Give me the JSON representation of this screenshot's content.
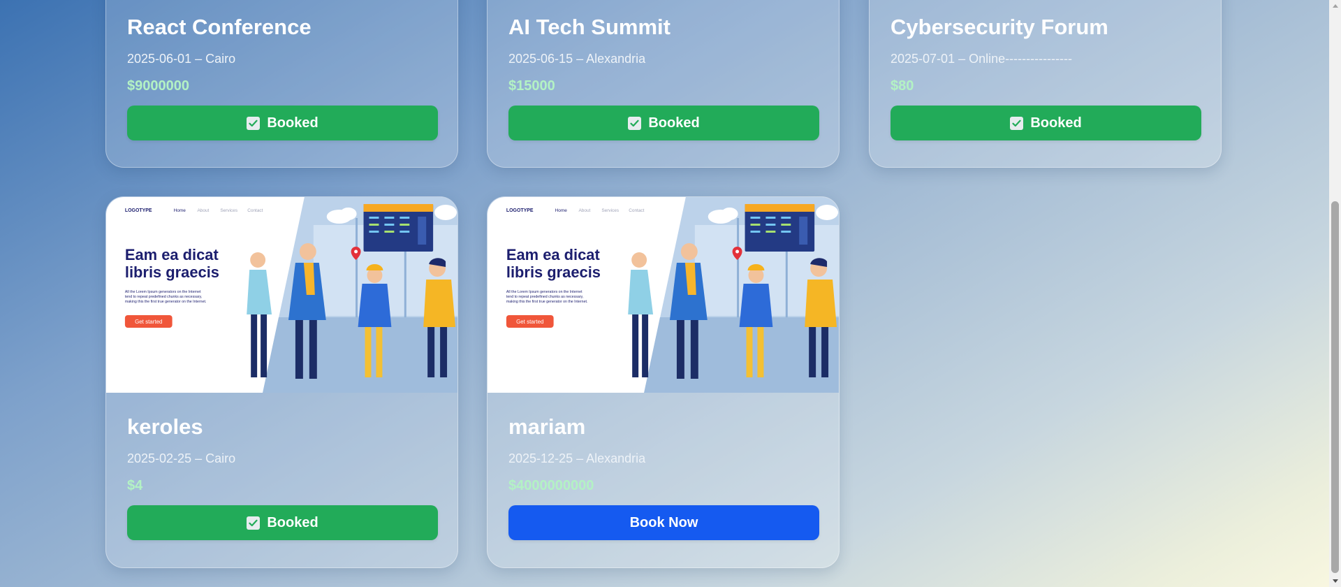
{
  "events": [
    {
      "title": "React Conference",
      "meta": "2025-06-01 – Cairo",
      "price": "$9000000",
      "button": "Booked",
      "status": "booked"
    },
    {
      "title": "AI Tech Summit",
      "meta": "2025-06-15 – Alexandria",
      "price": "$15000",
      "button": "Booked",
      "status": "booked"
    },
    {
      "title": "Cybersecurity Forum",
      "meta": "2025-07-01 – Online----------------",
      "price": "$80",
      "button": "Booked",
      "status": "booked"
    },
    {
      "title": "keroles",
      "meta": "2025-02-25 – Cairo",
      "price": "$4",
      "button": "Booked",
      "status": "booked"
    },
    {
      "title": "mariam",
      "meta": "2025-12-25 – Alexandria",
      "price": "$4000000000",
      "button": "Book Now",
      "status": "available"
    }
  ],
  "promo": {
    "logo": "LOGOTYPE",
    "nav": [
      "Home",
      "About",
      "Services",
      "Contact"
    ],
    "headline_line1": "Eam ea dicat",
    "headline_line2": "libris graecis",
    "body_line1": "All the Lorem Ipsum generators on the Internet",
    "body_line2": "tend to repeat predefined chunks as necessary,",
    "body_line3": "making this the first true generator on the Internet.",
    "cta": "Get started"
  },
  "icons": {
    "booked": "check-icon",
    "scroll_up": "chevron-up-icon",
    "scroll_down": "chevron-down-icon"
  },
  "colors": {
    "booked": "#22ab59",
    "book_now": "#155af0",
    "price": "#b3f2c4",
    "promo_accent": "#f0563a",
    "promo_navy": "#1c1e6e"
  }
}
